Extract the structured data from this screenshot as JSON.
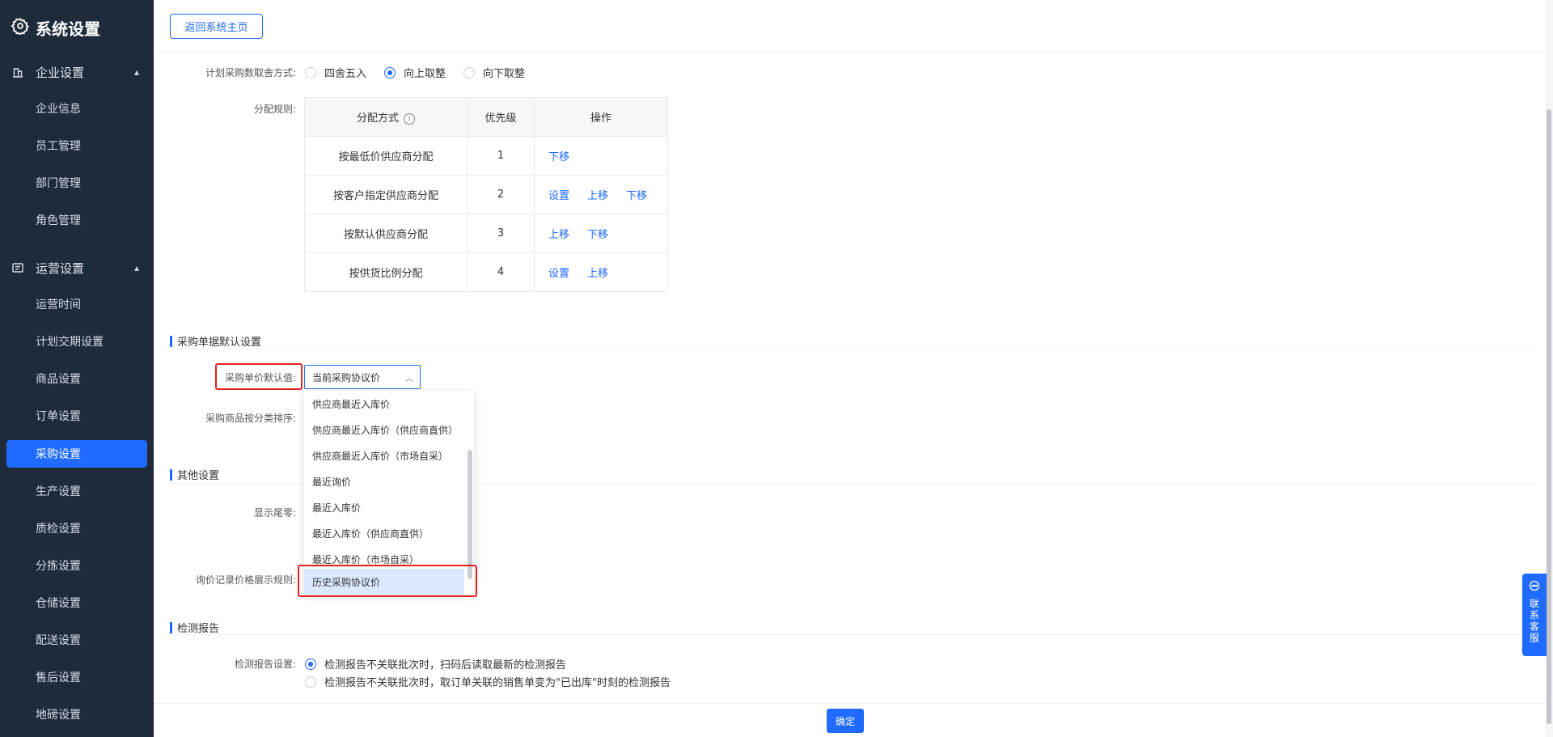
{
  "sidebar": {
    "title": "系统设置",
    "groups": [
      {
        "label": "企业设置",
        "items": [
          "企业信息",
          "员工管理",
          "部门管理",
          "角色管理"
        ]
      },
      {
        "label": "运营设置",
        "items": [
          "运营时间",
          "计划交期设置",
          "商品设置",
          "订单设置",
          "采购设置",
          "生产设置",
          "质检设置",
          "分拣设置",
          "仓储设置",
          "配送设置",
          "售后设置",
          "地磅设置"
        ]
      }
    ],
    "active": "采购设置"
  },
  "header": {
    "back_button": "返回系统主页"
  },
  "rounding": {
    "label": "计划采购数取舍方式:",
    "options": [
      "四舍五入",
      "向上取整",
      "向下取整"
    ],
    "selected": "向上取整"
  },
  "allocation": {
    "label": "分配规则:",
    "columns": [
      "分配方式",
      "优先级",
      "操作"
    ],
    "rows": [
      {
        "method": "按最低价供应商分配",
        "priority": "1",
        "ops": [
          "下移"
        ]
      },
      {
        "method": "按客户指定供应商分配",
        "priority": "2",
        "ops": [
          "设置",
          "上移",
          "下移"
        ]
      },
      {
        "method": "按默认供应商分配",
        "priority": "3",
        "ops": [
          "上移",
          "下移"
        ]
      },
      {
        "method": "按供货比例分配",
        "priority": "4",
        "ops": [
          "设置",
          "上移"
        ]
      }
    ]
  },
  "purchase_defaults": {
    "section_title": "采购单据默认设置",
    "unit_price_label": "采购单价默认值:",
    "unit_price_value": "当前采购协议价",
    "dropdown_options": [
      "供应商最近入库价",
      "供应商最近入库价（供应商直供）",
      "供应商最近入库价（市场自采）",
      "最近询价",
      "最近入库价",
      "最近入库价（供应商直供）",
      "最近入库价（市场自采）",
      "历史采购协议价"
    ],
    "highlighted_option": "历史采购协议价",
    "sort_label": "采购商品按分类排序:"
  },
  "other": {
    "section_title": "其他设置",
    "tail_label": "显示尾零:",
    "inquiry_label": "询价记录价格展示规则:"
  },
  "report": {
    "section_title": "检测报告",
    "label": "检测报告设置:",
    "options": [
      "检测报告不关联批次时，扫码后读取最新的检测报告",
      "检测报告不关联批次时，取订单关联的销售单变为\"已出库\"时刻的检测报告"
    ],
    "selected_index": 0
  },
  "footer": {
    "confirm": "确定"
  },
  "contact": {
    "label": "联系客服"
  },
  "colors": {
    "primary": "#1f6bff",
    "sidebar_bg": "#1f2a3b",
    "highlight": "#e62020"
  }
}
